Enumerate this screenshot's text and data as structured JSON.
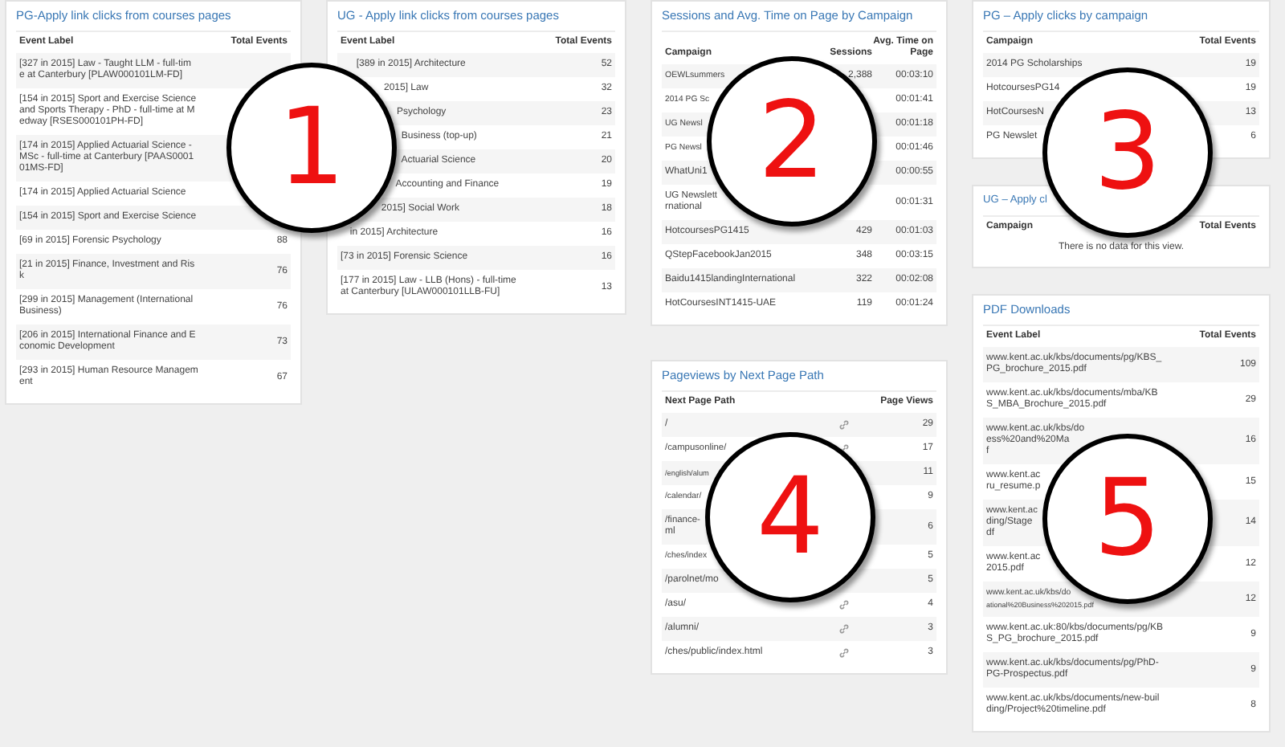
{
  "dashboard_columns": [
    [
      {
        "title": "PG-Apply link clicks from courses pages",
        "columns": [
          "Event Label",
          "Total Events"
        ],
        "rows": [
          {
            "label": [
              "[327 in 2015] Law - Taught LLM - full-tim",
              "e at Canterbury [PLAW000101LM-FD]"
            ]
          },
          {
            "label": [
              "[154 in 2015] Sport and Exercise Science",
              "and Sports Therapy - PhD - full-time at M",
              "edway [RSES000101PH-FD]"
            ]
          },
          {
            "label": [
              "[174 in 2015] Applied Actuarial Science -",
              "MSc - full-time at Canterbury [PAAS0001",
              "01MS-FD]"
            ]
          },
          {
            "label": [
              "[174 in 2015] Applied Actuarial Science"
            ]
          },
          {
            "label": [
              "[154 in 2015] Sport and Exercise Science"
            ]
          },
          {
            "label": [
              "[69 in 2015] Forensic Psychology"
            ],
            "values": [
              "88"
            ]
          },
          {
            "label": [
              "[21 in 2015] Finance, Investment and Ris",
              "k"
            ],
            "values": [
              "76"
            ]
          },
          {
            "label": [
              "[299 in 2015] Management (International",
              "Business)"
            ],
            "values": [
              "76"
            ]
          },
          {
            "label": [
              "[206 in 2015] International Finance and E",
              "conomic Development"
            ],
            "values": [
              "73"
            ]
          },
          {
            "label": [
              "[293 in 2015] Human Resource Managem",
              "ent"
            ],
            "values": [
              "67"
            ]
          }
        ]
      }
    ],
    [
      {
        "title": "UG - Apply link clicks from courses pages",
        "columns": [
          "Event Label",
          "Total Events"
        ],
        "rows": [
          {
            "label": [
              "[389 in 2015] Architecture"
            ],
            "values": [
              "52"
            ]
          },
          {
            "label": [
              "2015] Law"
            ],
            "values": [
              "32"
            ]
          },
          {
            "label": [
              "Psychology"
            ],
            "values": [
              "23"
            ]
          },
          {
            "label": [
              "Business (top-up)"
            ],
            "values": [
              "21"
            ]
          },
          {
            "label": [
              "Actuarial Science"
            ],
            "values": [
              "20"
            ]
          },
          {
            "label": [
              "Accounting and Finance"
            ],
            "values": [
              "19"
            ]
          },
          {
            "label": [
              "2015] Social Work"
            ],
            "values": [
              "18"
            ]
          },
          {
            "label": [
              "in 2015] Architecture"
            ],
            "values": [
              "16"
            ]
          },
          {
            "label": [
              "[73 in 2015] Forensic Science"
            ],
            "values": [
              "16"
            ]
          },
          {
            "label": [
              "[177 in 2015] Law - LLB (Hons) - full-time",
              "at Canterbury [ULAW000101LLB-FU]"
            ],
            "values": [
              "13"
            ]
          }
        ]
      }
    ],
    [
      {
        "title": "Sessions and Avg. Time on Page by Campaign",
        "columns": [
          "Campaign",
          "Sessions",
          "Avg. Time on Page"
        ],
        "rows": [
          {
            "label": [
              "OEWLsummers"
            ],
            "values": [
              "2,388",
              "00:03:10"
            ]
          },
          {
            "label": [
              "2014 PG Sc"
            ],
            "values": [
              "00:01:41"
            ]
          },
          {
            "label": [
              "UG Newsl"
            ],
            "values": [
              "00:01:18"
            ]
          },
          {
            "label": [
              "PG Newsl"
            ],
            "values": [
              "00:01:46"
            ]
          },
          {
            "label": [
              "WhatUni1"
            ],
            "values": [
              "00:00:55"
            ]
          },
          {
            "label": [
              "UG Newslett",
              "rnational"
            ],
            "values": [
              "00:01:31"
            ]
          },
          {
            "label": [
              "HotcoursesPG1415"
            ],
            "values": [
              "429",
              "00:01:03"
            ]
          },
          {
            "label": [
              "QStepFacebookJan2015"
            ],
            "values": [
              "348",
              "00:03:15"
            ]
          },
          {
            "label": [
              "Baidu1415landingInternational"
            ],
            "values": [
              "322",
              "00:02:08"
            ]
          },
          {
            "label": [
              "HotCoursesINT1415-UAE"
            ],
            "values": [
              "119",
              "00:01:24"
            ]
          }
        ]
      },
      {
        "title": "Pageviews by Next Page Path",
        "columns": [
          "Next Page Path",
          "Page Views"
        ],
        "rows": [
          {
            "label": [
              "/"
            ],
            "link": true,
            "values": [
              "29"
            ]
          },
          {
            "label": [
              "/campusonline/"
            ],
            "link": true,
            "values": [
              "17"
            ]
          },
          {
            "label": [
              "/english/alum"
            ],
            "link": false,
            "values": [
              "11"
            ]
          },
          {
            "label": [
              "/calendar/"
            ],
            "link": false,
            "values": [
              "9"
            ]
          },
          {
            "label": [
              "/finance-",
              "ml"
            ],
            "link": false,
            "values": [
              "6"
            ]
          },
          {
            "label": [
              "/ches/index"
            ],
            "link": false,
            "values": [
              "5"
            ]
          },
          {
            "label": [
              "/parolnet/mo"
            ],
            "link": false,
            "values": [
              "5"
            ]
          },
          {
            "label": [
              "/asu/"
            ],
            "link": true,
            "values": [
              "4"
            ]
          },
          {
            "label": [
              "/alumni/"
            ],
            "link": true,
            "values": [
              "3"
            ]
          },
          {
            "label": [
              "/ches/public/index.html"
            ],
            "link": true,
            "values": [
              "3"
            ]
          }
        ]
      }
    ],
    [
      {
        "title": "PG – Apply clicks by campaign",
        "columns": [
          "Campaign",
          "Total Events"
        ],
        "rows": [
          {
            "label": [
              "2014 PG Scholarships"
            ],
            "values": [
              "19"
            ]
          },
          {
            "label": [
              "HotcoursesPG14"
            ],
            "values": [
              "19"
            ]
          },
          {
            "label": [
              "HotCoursesN"
            ],
            "values": [
              "13"
            ]
          },
          {
            "label": [
              "PG Newslet"
            ],
            "values": [
              "6"
            ]
          }
        ]
      },
      {
        "title": "UG – Apply cl",
        "columns": [
          "Campaign",
          "Total Events"
        ],
        "empty_message": "There is no data for this view."
      },
      {
        "title": "PDF Downloads",
        "columns": [
          "Event Label",
          "Total Events"
        ],
        "rows": [
          {
            "label": [
              "www.kent.ac.uk/kbs/documents/pg/KBS_",
              "PG_brochure_2015.pdf"
            ],
            "values": [
              "109"
            ]
          },
          {
            "label": [
              "www.kent.ac.uk/kbs/documents/mba/KB",
              "S_MBA_Brochure_2015.pdf"
            ],
            "values": [
              "29"
            ]
          },
          {
            "label": [
              "www.kent.ac.uk/kbs/do",
              "ess%20and%20Ma",
              "f"
            ],
            "values": [
              "16"
            ]
          },
          {
            "label": [
              "www.kent.ac",
              "ru_resume.p"
            ],
            "values": [
              "15"
            ]
          },
          {
            "label": [
              "www.kent.ac",
              "ding/Stage",
              "df"
            ],
            "values": [
              "14"
            ]
          },
          {
            "label": [
              "www.kent.ac",
              "2015.pdf"
            ],
            "values": [
              "12"
            ]
          },
          {
            "label": [
              "www.kent.ac.uk/kbs/do",
              "ational%20Business%202015.pdf"
            ],
            "values": [
              "12"
            ]
          },
          {
            "label": [
              "www.kent.ac.uk:80/kbs/documents/pg/KB",
              "S_PG_brochure_2015.pdf"
            ],
            "values": [
              "9"
            ]
          },
          {
            "label": [
              "www.kent.ac.uk/kbs/documents/pg/PhD-",
              "PG-Prospectus.pdf"
            ],
            "values": [
              "9"
            ]
          },
          {
            "label": [
              "www.kent.ac.uk/kbs/documents/new-buil",
              "ding/Project%20timeline.pdf"
            ],
            "values": [
              "8"
            ]
          }
        ]
      }
    ]
  ],
  "callouts": [
    {
      "number": "1"
    },
    {
      "number": "2"
    },
    {
      "number": "3"
    },
    {
      "number": "4"
    },
    {
      "number": "5"
    }
  ]
}
